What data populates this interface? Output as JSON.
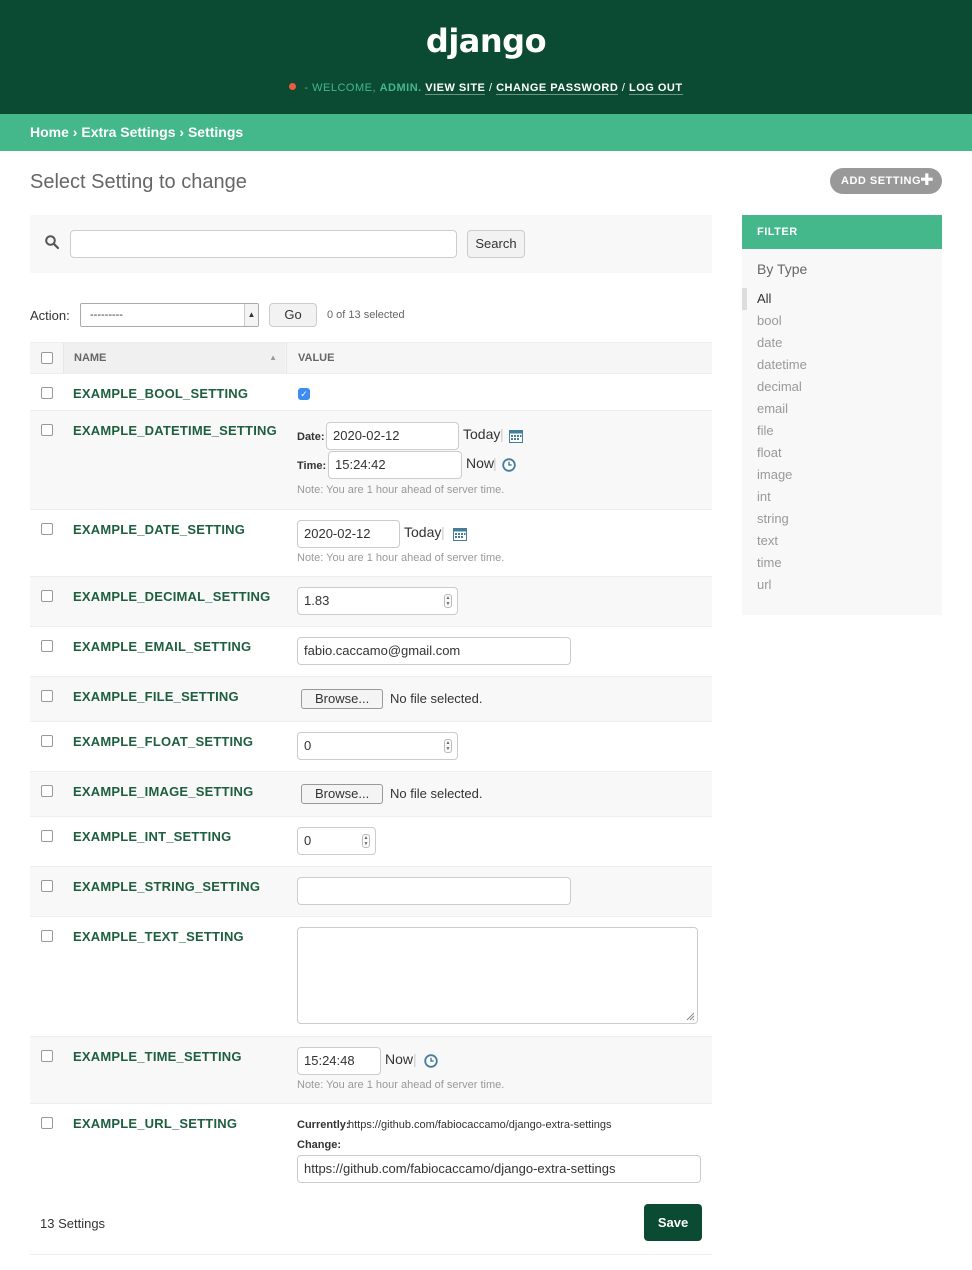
{
  "header": {
    "brand": "django",
    "welcome": "- Welcome,",
    "username": "admin.",
    "view_site": "View site",
    "change_password": "Change password",
    "log_out": "Log out",
    "sep1": "/",
    "sep2": "/"
  },
  "breadcrumbs": {
    "home": "Home",
    "app": "Extra Settings",
    "current": "Settings",
    "sep": "›"
  },
  "title": "Select Setting to change",
  "add_button": "Add Setting",
  "search": {
    "value": "",
    "button": "Search"
  },
  "actions": {
    "label": "Action:",
    "selected": "---------",
    "go": "Go",
    "counter": "0 of 13 selected"
  },
  "table": {
    "col_name": "Name",
    "col_value": "Value",
    "sort_indicator": "▲"
  },
  "rows": {
    "bool": {
      "name": "EXAMPLE_BOOL_SETTING",
      "checked": true
    },
    "datetime": {
      "name": "EXAMPLE_DATETIME_SETTING",
      "date_label": "Date:",
      "date_value": "2020-02-12",
      "today": "Today",
      "time_label": "Time:",
      "time_value": "15:24:42",
      "now": "Now",
      "note": "Note: You are 1 hour ahead of server time."
    },
    "date": {
      "name": "EXAMPLE_DATE_SETTING",
      "value": "2020-02-12",
      "today": "Today",
      "note": "Note: You are 1 hour ahead of server time."
    },
    "decimal": {
      "name": "EXAMPLE_DECIMAL_SETTING",
      "value": "1.83"
    },
    "email": {
      "name": "EXAMPLE_EMAIL_SETTING",
      "value": "fabio.caccamo@gmail.com"
    },
    "file": {
      "name": "EXAMPLE_FILE_SETTING",
      "button": "Browse...",
      "status": "No file selected."
    },
    "float": {
      "name": "EXAMPLE_FLOAT_SETTING",
      "value": "0"
    },
    "image": {
      "name": "EXAMPLE_IMAGE_SETTING",
      "button": "Browse...",
      "status": "No file selected."
    },
    "int": {
      "name": "EXAMPLE_INT_SETTING",
      "value": "0"
    },
    "string": {
      "name": "EXAMPLE_STRING_SETTING",
      "value": ""
    },
    "text": {
      "name": "EXAMPLE_TEXT_SETTING",
      "value": ""
    },
    "time": {
      "name": "EXAMPLE_TIME_SETTING",
      "value": "15:24:48",
      "now": "Now",
      "note": "Note: You are 1 hour ahead of server time."
    },
    "url": {
      "name": "EXAMPLE_URL_SETTING",
      "currently_label": "Currently:",
      "currently_value": "https://github.com/fabiocaccamo/django-extra-settings",
      "change_label": "Change:",
      "value": "https://github.com/fabiocaccamo/django-extra-settings"
    }
  },
  "filter": {
    "title": "Filter",
    "subtitle": "By Type",
    "items": [
      "All",
      "bool",
      "date",
      "datetime",
      "decimal",
      "email",
      "file",
      "float",
      "image",
      "int",
      "string",
      "text",
      "time",
      "url"
    ],
    "selected": "All"
  },
  "footer": {
    "count": "13 Settings",
    "save": "Save"
  },
  "colors": {
    "header_bg": "#0c4b33",
    "breadcrumb_bg": "#44b78b",
    "link_green": "#1e5f3f",
    "alert_dot": "#ec5b3e"
  }
}
